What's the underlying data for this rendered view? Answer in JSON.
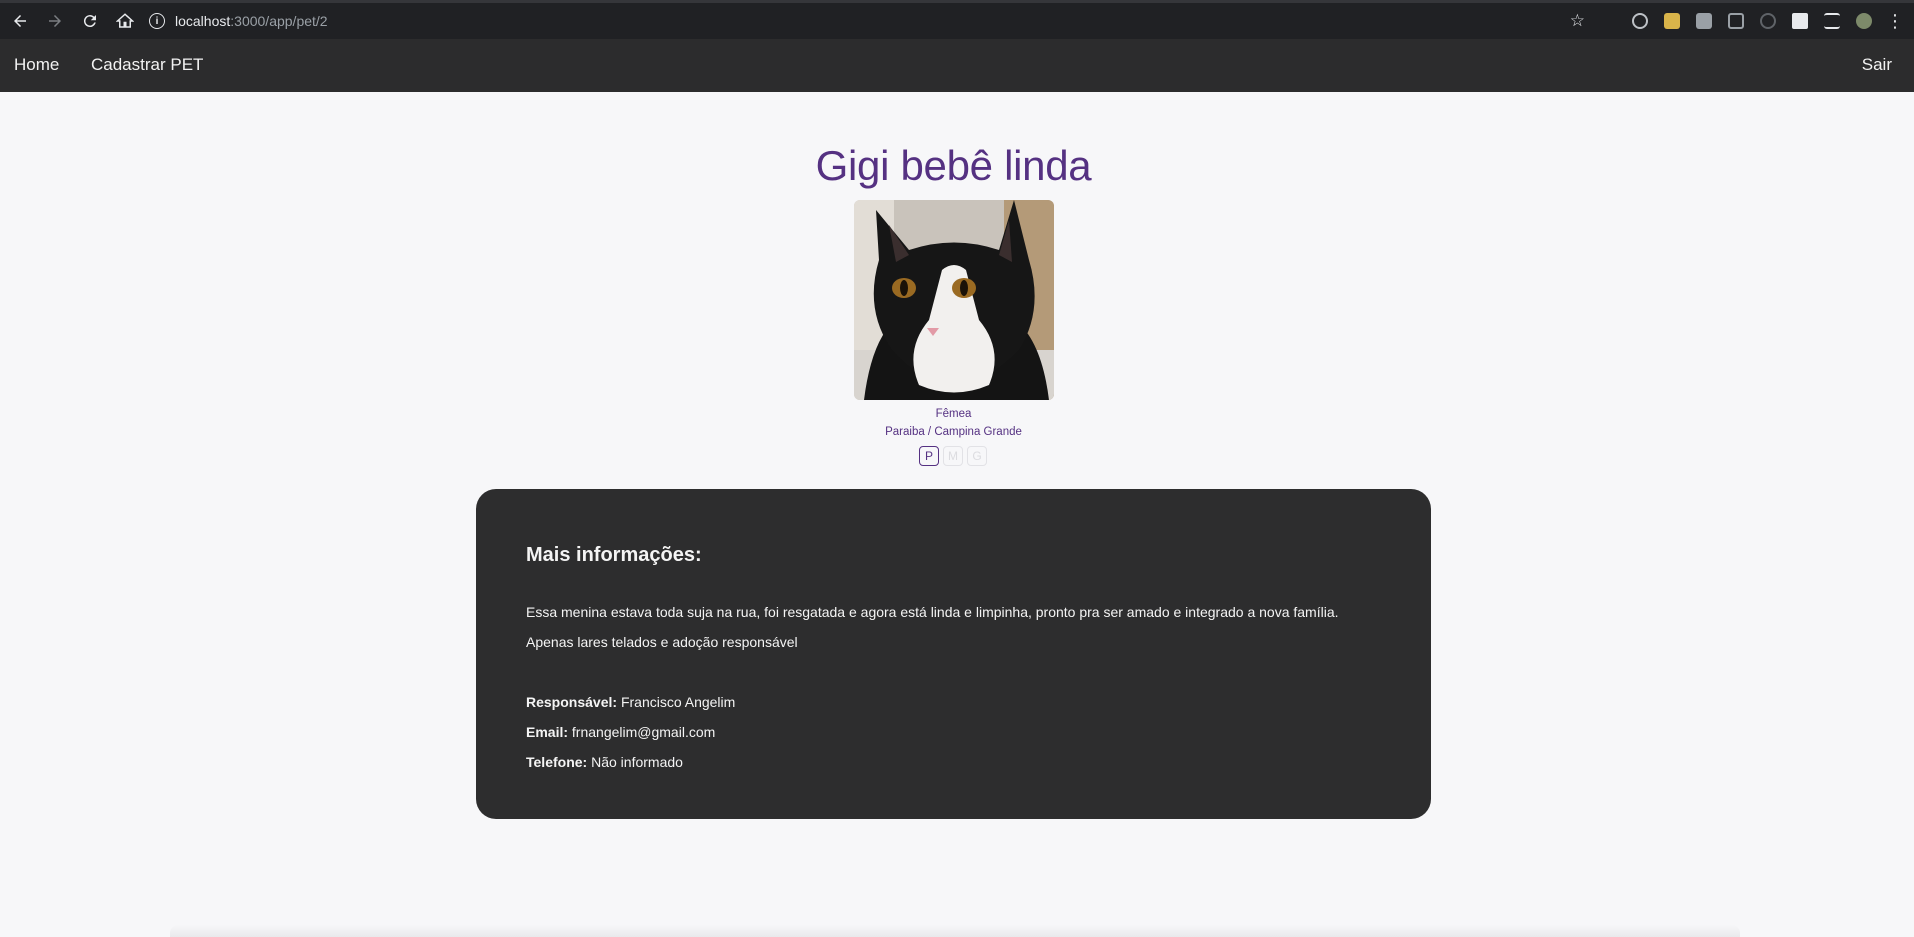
{
  "browser": {
    "url_host": "localhost",
    "url_rest": ":3000/app/pet/2",
    "icons": [
      "back-icon",
      "forward-icon",
      "reload-icon",
      "home-icon",
      "info-icon",
      "star-icon",
      "menu-icon"
    ]
  },
  "navbar": {
    "home": "Home",
    "register": "Cadastrar PET",
    "logout": "Sair"
  },
  "pet": {
    "name": "Gigi bebê linda",
    "sex": "Fêmea",
    "location": "Paraiba / Campina Grande",
    "sizes": [
      {
        "label": "P",
        "active": true
      },
      {
        "label": "M",
        "active": false
      },
      {
        "label": "G",
        "active": false
      }
    ]
  },
  "info": {
    "heading": "Mais informações:",
    "description_line1": "Essa menina estava toda suja na rua, foi resgatada e agora está linda e limpinha, pronto pra ser amado e integrado a nova família.",
    "description_line2": "Apenas lares telados e adoção responsável",
    "responsavel_label": "Responsável:",
    "responsavel_value": "Francisco Angelim",
    "email_label": "Email:",
    "email_value": "frnangelim@gmail.com",
    "telefone_label": "Telefone:",
    "telefone_value": "Não informado"
  },
  "colors": {
    "accent": "#553182",
    "navbar_bg": "#2c2c2d",
    "card_bg": "#2d2d2e",
    "page_bg": "#f7f7f9"
  }
}
